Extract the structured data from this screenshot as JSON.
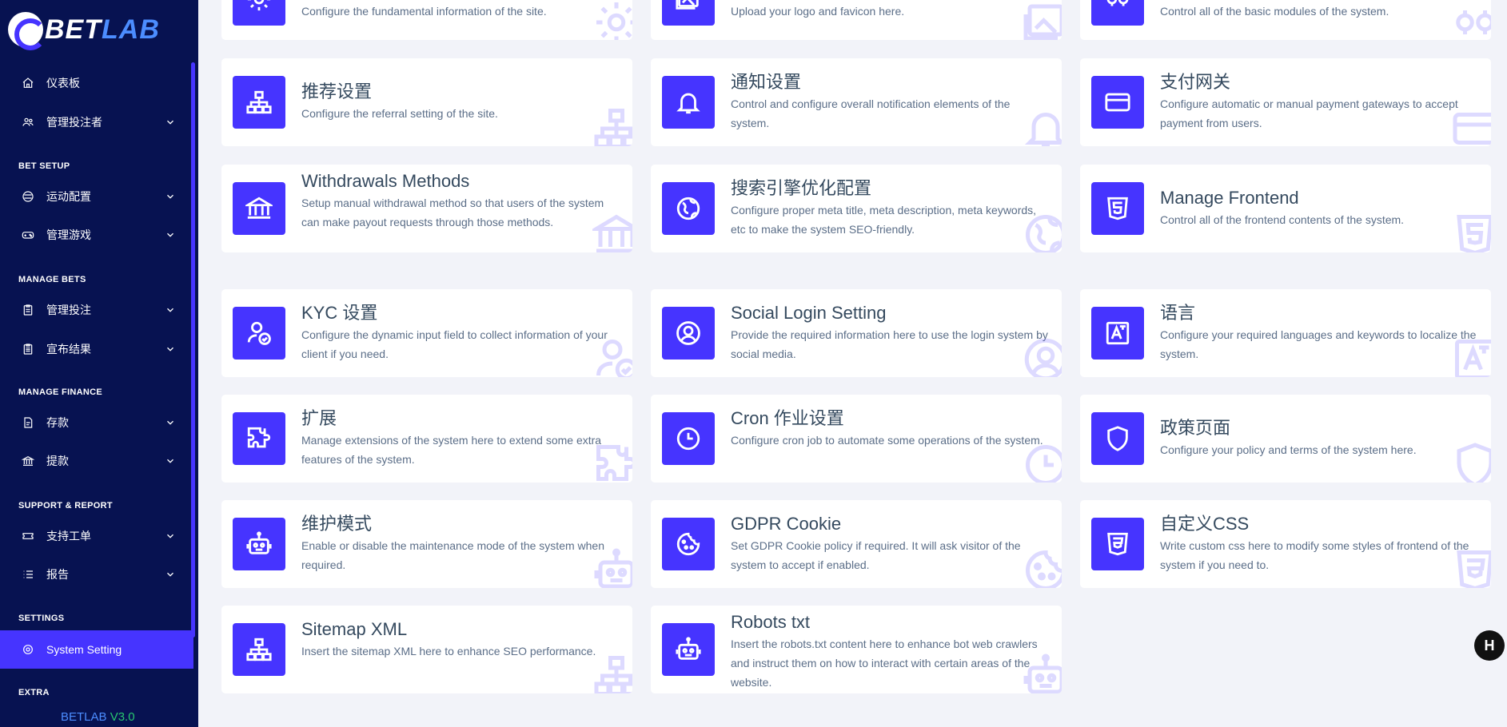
{
  "brand": {
    "part1": "BET",
    "part2": "LAB",
    "version_name": "BETLAB",
    "version_num": "V3.0"
  },
  "sidebar": {
    "items": [
      {
        "label": "仪表板",
        "icon": "home-icon",
        "chevron": false
      },
      {
        "label": "管理投注者",
        "icon": "users-icon",
        "chevron": true
      },
      {
        "label": "运动配置",
        "icon": "sport-icon",
        "chevron": true
      },
      {
        "label": "管理游戏",
        "icon": "gamepad-icon",
        "chevron": true
      },
      {
        "label": "管理投注",
        "icon": "clipboard-icon",
        "chevron": true
      },
      {
        "label": "宣布结果",
        "icon": "clipboard-list-icon",
        "chevron": true
      },
      {
        "label": "存款",
        "icon": "deposit-icon",
        "chevron": true
      },
      {
        "label": "提款",
        "icon": "bank-icon",
        "chevron": true
      },
      {
        "label": "支持工单",
        "icon": "ticket-icon",
        "chevron": true
      },
      {
        "label": "报告",
        "icon": "list-icon",
        "chevron": true
      },
      {
        "label": "System Setting",
        "icon": "gear-icon",
        "chevron": false,
        "active": true
      }
    ],
    "headers": [
      "BET SETUP",
      "MANAGE BETS",
      "MANAGE FINANCE",
      "SUPPORT & REPORT",
      "SETTINGS",
      "EXTRA"
    ]
  },
  "cards": [
    {
      "title": "",
      "desc": "Configure the fundamental information of the site.",
      "icon": "gear-icon"
    },
    {
      "title": "",
      "desc": "Upload your logo and favicon here.",
      "icon": "image-icon"
    },
    {
      "title": "",
      "desc": "Control all of the basic modules of the system.",
      "icon": "cogs-icon"
    },
    {
      "title": "推荐设置",
      "desc": "Configure the referral setting of the site.",
      "icon": "sitemap-icon"
    },
    {
      "title": "通知设置",
      "desc": "Control and configure overall notification elements of the system.",
      "icon": "bell-icon"
    },
    {
      "title": "支付网关",
      "desc": "Configure automatic or manual payment gateways to accept payment from users.",
      "icon": "credit-card-icon"
    },
    {
      "title": "Withdrawals Methods",
      "desc": "Setup manual withdrawal method so that users of the system can make payout requests through those methods.",
      "icon": "bank-icon"
    },
    {
      "title": "搜索引擎优化配置",
      "desc": "Configure proper meta title, meta description, meta keywords, etc to make the system SEO-friendly.",
      "icon": "globe-icon"
    },
    {
      "title": "Manage Frontend",
      "desc": "Control all of the frontend contents of the system.",
      "icon": "html5-icon"
    },
    {
      "title": "KYC 设置",
      "desc": "Configure the dynamic input field to collect information of your client if you need.",
      "icon": "user-check-icon"
    },
    {
      "title": "Social Login Setting",
      "desc": "Provide the required information here to use the login system by social media.",
      "icon": "user-circle-icon"
    },
    {
      "title": "语言",
      "desc": "Configure your required languages and keywords to localize the system.",
      "icon": "language-icon"
    },
    {
      "title": "扩展",
      "desc": "Manage extensions of the system here to extend some extra features of the system.",
      "icon": "puzzle-icon"
    },
    {
      "title": "Cron 作业设置",
      "desc": "Configure cron job to automate some operations of the system.",
      "icon": "clock-icon"
    },
    {
      "title": "政策页面",
      "desc": "Configure your policy and terms of the system here.",
      "icon": "shield-icon"
    },
    {
      "title": "维护模式",
      "desc": "Enable or disable the maintenance mode of the system when required.",
      "icon": "robot-icon"
    },
    {
      "title": "GDPR Cookie",
      "desc": "Set GDPR Cookie policy if required. It will ask visitor of the system to accept if enabled.",
      "icon": "cookie-icon"
    },
    {
      "title": "自定义CSS",
      "desc": "Write custom css here to modify some styles of frontend of the system if you need to.",
      "icon": "css3-icon"
    },
    {
      "title": "Sitemap XML",
      "desc": "Insert the sitemap XML here to enhance SEO performance.",
      "icon": "sitemap-icon"
    },
    {
      "title": "Robots txt",
      "desc": "Insert the robots.txt content here to enhance bot web crawlers and instruct them on how to interact with certain areas of the website.",
      "icon": "robot-icon"
    }
  ],
  "help_button": {
    "label": "H",
    "icon": "help-icon"
  },
  "colors": {
    "sidebar_bg": "#071251",
    "accent": "#4634ff",
    "page_bg": "#f2f3f9"
  }
}
